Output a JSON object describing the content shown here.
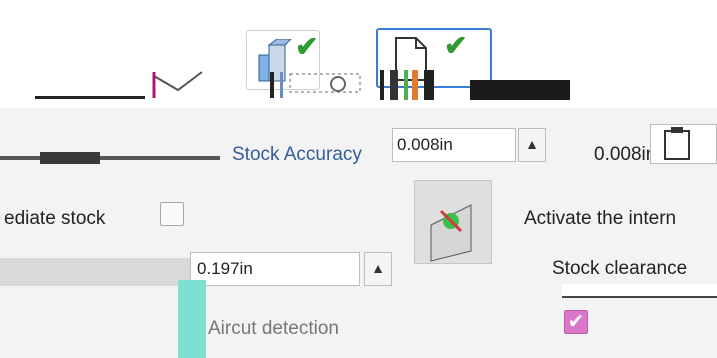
{
  "toolbar": {
    "stock_button": "stock-model-icon",
    "document_button": "document-icon",
    "status_color": "#2f9a2f",
    "accent": "#3a7bd5"
  },
  "params": {
    "stock_accuracy_label": "Stock Accuracy",
    "stock_accuracy_value": "0.008in",
    "stock_accuracy_readout": "0.008in",
    "intermediate_stock_label": "ediate stock",
    "intermediate_stock_checked": false,
    "activate_label": "Activate the intern",
    "stock_clearance_label": "Stock clearance",
    "stock_clearance_value": "0.197in",
    "aircut_label": "Aircut detection",
    "aircut_checked": true
  }
}
